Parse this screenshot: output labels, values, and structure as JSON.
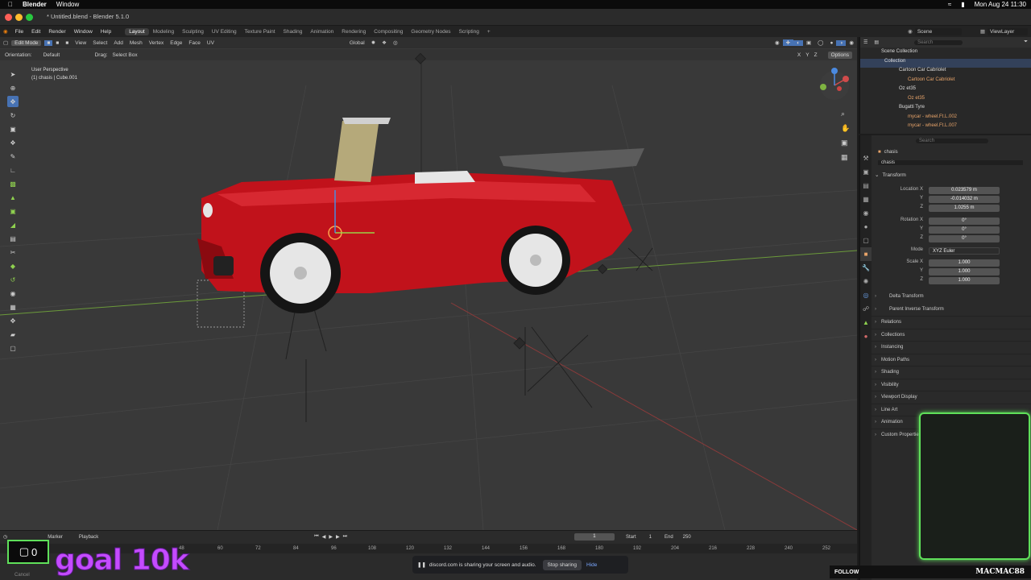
{
  "macbar": {
    "app": "Blender",
    "menu_window": "Window",
    "datetime": "Mon Aug 24  11:30"
  },
  "window": {
    "title": "* Untitled.blend - Blender 5.1.0"
  },
  "topmenu": {
    "items": [
      "File",
      "Edit",
      "Render",
      "Window",
      "Help"
    ],
    "workspaces": [
      "Layout",
      "Modeling",
      "Sculpting",
      "UV Editing",
      "Texture Paint",
      "Shading",
      "Animation",
      "Rendering",
      "Compositing",
      "Geometry Nodes",
      "Scripting",
      "+"
    ],
    "active_workspace": "Layout",
    "scene": "Scene",
    "view_layer": "ViewLayer"
  },
  "viewport_header": {
    "mode": "Edit Mode",
    "menus": [
      "View",
      "Select",
      "Add",
      "Mesh",
      "Vertex",
      "Edge",
      "Face",
      "UV"
    ],
    "transform_orientation": "Global"
  },
  "tool_settings": {
    "orientation_label": "Orientation:",
    "orientation_value": "Default",
    "drag_label": "Drag:",
    "drag_value": "Select Box",
    "options": "Options",
    "axes": [
      "X",
      "Y",
      "Z"
    ]
  },
  "viewport_overlay": {
    "view_name": "User Perspective",
    "object_info": "(1) chasis | Cube.001"
  },
  "outliner": {
    "search_placeholder": "Search",
    "items": [
      {
        "label": "Scene Collection"
      },
      {
        "label": "Collection"
      },
      {
        "label": "Cartoon Car Cabriolet"
      },
      {
        "label": "Cartoon Car Cabriolet"
      },
      {
        "label": "Oz et35"
      },
      {
        "label": "Oz et35"
      },
      {
        "label": "Bugatti Tyre"
      },
      {
        "label": "mycar - wheel.Ft.L.002"
      },
      {
        "label": "mycar - wheel.Ft.L.007"
      }
    ]
  },
  "properties": {
    "search_placeholder": "Search",
    "object_name": "chasis",
    "object_field": "chasis",
    "transform_label": "Transform",
    "location_label": "Location X",
    "location": {
      "x": "0.023579 m",
      "y": "-0.014032 m",
      "z": "1.0255 m"
    },
    "rotation_label": "Rotation X",
    "rotation": {
      "x": "0°",
      "y": "0°",
      "z": "0°"
    },
    "mode_label": "Mode",
    "mode_value": "XYZ Euler",
    "scale_label": "Scale X",
    "scale": {
      "x": "1.000",
      "y": "1.000",
      "z": "1.000"
    },
    "axis_y": "Y",
    "axis_z": "Z",
    "subsections": [
      "Delta Transform",
      "Parent Inverse Transform"
    ],
    "sections": [
      "Relations",
      "Collections",
      "Instancing",
      "Motion Paths",
      "Shading",
      "Visibility",
      "Viewport Display",
      "Line Art",
      "Animation",
      "Custom Properties"
    ]
  },
  "timeline": {
    "playback": "Playback",
    "marker": "Marker",
    "current_frame": "1",
    "start_label": "Start",
    "start_value": "1",
    "end_label": "End",
    "end_value": "250",
    "ticks": [
      "48",
      "60",
      "72",
      "84",
      "96",
      "108",
      "120",
      "132",
      "144",
      "156",
      "168",
      "180",
      "192",
      "204",
      "216",
      "228",
      "240",
      "252"
    ],
    "cancel": "Cancel"
  },
  "overlay": {
    "counter": "0",
    "goal_text": "goal 10k",
    "follow_label": "FOLLOW",
    "follow_name": "MACMAC88",
    "cam_border_color": "#5fe05a",
    "goal_color": "#c44bff"
  },
  "share_notice": {
    "text": "discord.com is sharing your screen and audio.",
    "stop": "Stop sharing",
    "hide": "Hide"
  },
  "colors": {
    "accent": "#4772b3",
    "car_red": "#c1121b",
    "x_axis": "#d04b4b",
    "y_axis": "#7fb341"
  }
}
